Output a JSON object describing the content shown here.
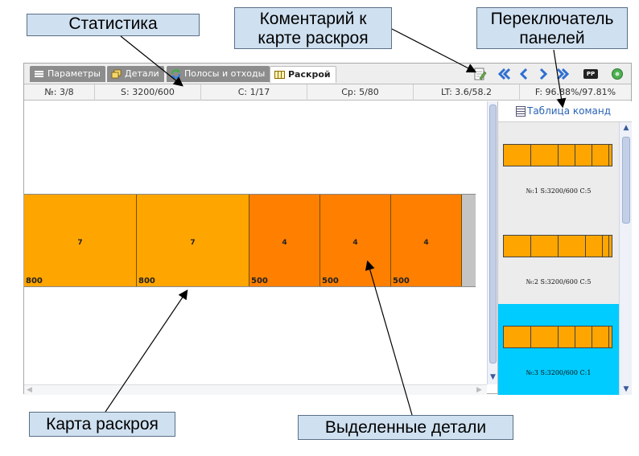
{
  "callouts": {
    "stats": "Статистика",
    "comment_line1": "Коментарий к",
    "comment_line2": "карте раскроя",
    "switcher_line1": "Переключатель",
    "switcher_line2": "панелей",
    "map": "Карта раскроя",
    "selected": "Выделенные детали"
  },
  "tabs": [
    {
      "label": "Параметры",
      "icon": "list-icon"
    },
    {
      "label": "Детали",
      "icon": "parts-icon"
    },
    {
      "label": "Полосы и отходы",
      "icon": "refresh-icon"
    },
    {
      "label": "Раскрой",
      "icon": "columns-icon",
      "active": true
    }
  ],
  "toolbar": {
    "comment_icon": "note-edit-icon",
    "first_icon": "double-chevron-left-icon",
    "prev_icon": "chevron-left-icon",
    "next_icon": "chevron-right-icon",
    "last_icon": "double-chevron-right-icon",
    "pp_label": "PP",
    "help_icon": "help-circle-icon"
  },
  "stats": {
    "number": "№: 3/8",
    "size": "S: 3200/600",
    "count": "C: 1/17",
    "cp": "Cp: 5/80",
    "lt": "LT: 3.6/58.2",
    "f": "F: 96.88%/97.81%"
  },
  "cut_map": {
    "stock_length": 3200,
    "pieces": [
      {
        "qty": "7",
        "length": "800",
        "color": "#ffa500"
      },
      {
        "qty": "7",
        "length": "800",
        "color": "#ffa500"
      },
      {
        "qty": "4",
        "length": "500",
        "color": "#ff7f00"
      },
      {
        "qty": "4",
        "length": "500",
        "color": "#ff7f00"
      },
      {
        "qty": "4",
        "length": "500",
        "color": "#ff7f00"
      }
    ],
    "waste_color": "#c4c4c4"
  },
  "panel": {
    "header": "Таблица команд",
    "header_icon": "table-icon",
    "plans": [
      {
        "caption": "№:1 S:3200/600 C:5",
        "segments": [
          800,
          800,
          500,
          500,
          500
        ],
        "selected": false
      },
      {
        "caption": "№:2 S:3200/600 C:5",
        "segments": [
          800,
          800,
          800,
          500,
          200
        ],
        "selected": false
      },
      {
        "caption": "№:3 S:3200/600 C:1",
        "segments": [
          800,
          800,
          500,
          500,
          500
        ],
        "selected": true
      }
    ],
    "selected_color": "#00ccff"
  }
}
